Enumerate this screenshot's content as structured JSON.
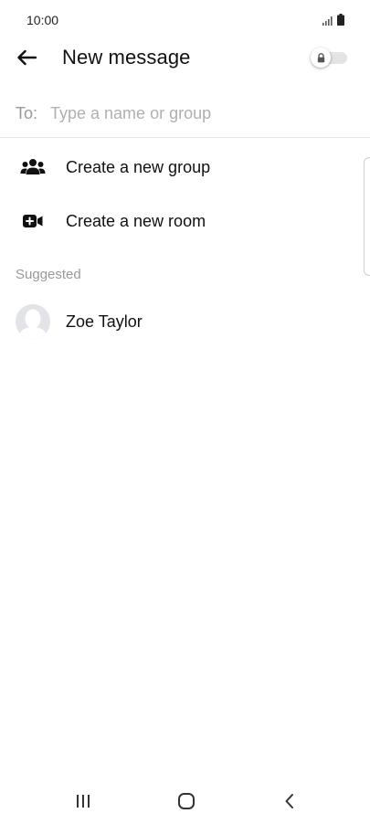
{
  "status_bar": {
    "time": "10:00",
    "icons": [
      "signal-icon",
      "battery-icon"
    ]
  },
  "app_bar": {
    "back_icon": "arrow-left-icon",
    "title": "New message",
    "toggle": {
      "icon": "lock-icon",
      "state": "off"
    }
  },
  "recipient": {
    "label": "To:",
    "value": "",
    "placeholder": "Type a name or group"
  },
  "actions": [
    {
      "label": "Create a new group",
      "icon": "group-icon"
    },
    {
      "label": "Create a new room",
      "icon": "video-room-icon"
    }
  ],
  "suggested": {
    "header": "Suggested",
    "contacts": [
      {
        "name": "Zoe Taylor",
        "avatar": "default-avatar-icon"
      }
    ]
  },
  "nav_bar": {
    "buttons": [
      "recent-apps-icon",
      "home-icon",
      "back-nav-icon"
    ]
  },
  "colors": {
    "background": "#ffffff",
    "text_primary": "#111111",
    "text_secondary": "#9a9a9a",
    "divider": "#e6e6e6",
    "avatar_bg": "#e3e4e8"
  }
}
